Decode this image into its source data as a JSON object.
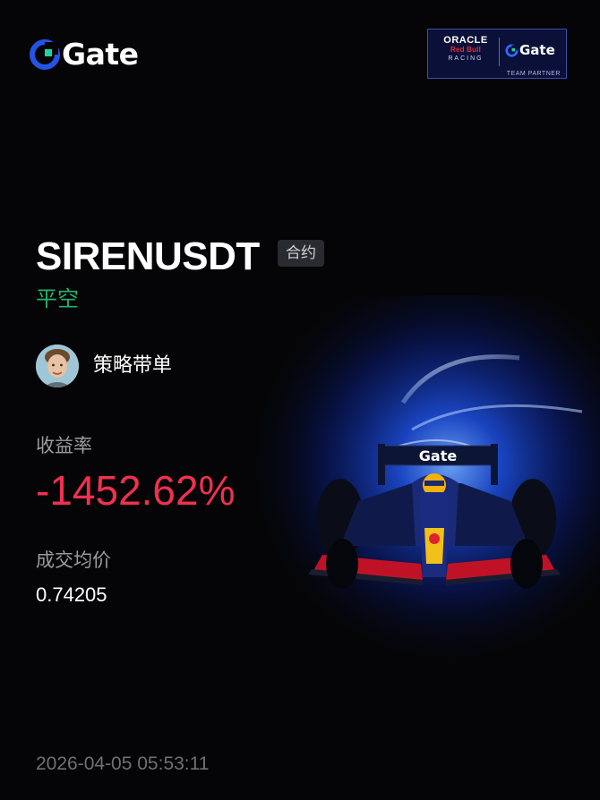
{
  "brand": {
    "name": "Gate",
    "accent_color": "#2354e6",
    "icon": "gate-logo-icon"
  },
  "partner_badge": {
    "oracle": "ORACLE",
    "red_bull": "Red Bull",
    "racing": "RACING",
    "gate": "Gate",
    "team_partner": "TEAM PARTNER"
  },
  "trade": {
    "symbol": "SIRENUSDT",
    "type_tag": "合约",
    "side": "平空",
    "side_color": "#21b36b"
  },
  "trader": {
    "name": "策略带单",
    "avatar_icon": "avatar-icon"
  },
  "roi": {
    "label": "收益率",
    "value": "-1452.62%",
    "color": "#f0304f"
  },
  "avg_price": {
    "label": "成交均价",
    "value": "0.74205"
  },
  "timestamp": "2026-04-05 05:53:11",
  "hero_image": {
    "icon": "f1-car-illustration"
  }
}
